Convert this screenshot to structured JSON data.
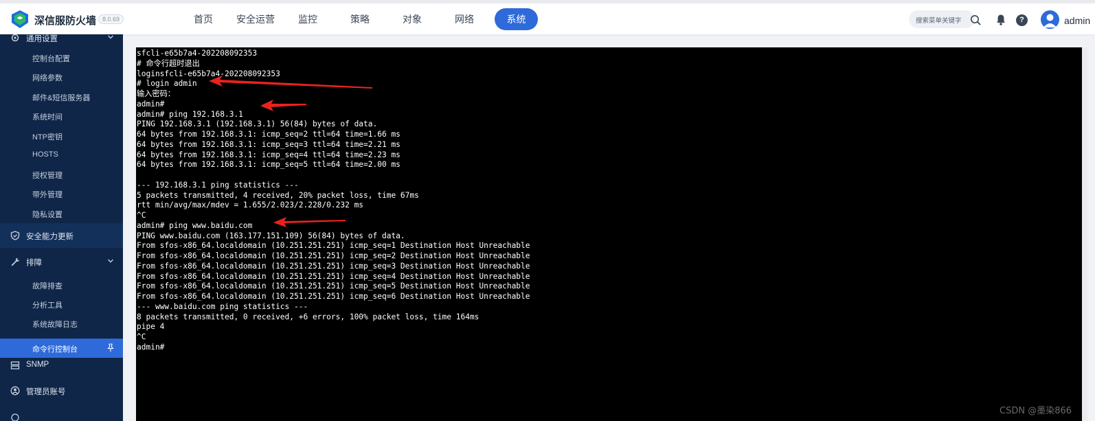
{
  "header": {
    "brand": "深信服防火墙",
    "version": "8.0.69",
    "nav": [
      {
        "label": "首页"
      },
      {
        "label": "安全运营"
      },
      {
        "label": "监控"
      },
      {
        "label": "策略"
      },
      {
        "label": "对象"
      },
      {
        "label": "网络"
      },
      {
        "label": "系统",
        "active": true
      }
    ],
    "search_placeholder": "搜索菜单关键字",
    "username": "admin",
    "help_glyph": "?"
  },
  "sidebar": {
    "top_section_label": "通用设置",
    "general_items": [
      "控制台配置",
      "网络参数",
      "邮件&短信服务器",
      "系统时间",
      "NTP密钥",
      "HOSTS",
      "授权管理",
      "带外管理",
      "隐私设置"
    ],
    "security_update_label": "安全能力更新",
    "troubleshoot_label": "排障",
    "troubleshoot_items": [
      "故障排查",
      "分析工具",
      "系统故障日志"
    ],
    "active_item": "命令行控制台",
    "snmp_label": "SNMP",
    "admin_account_label": "管理员账号",
    "accent_color": "#2e6ad9",
    "background_color": "#0f2648"
  },
  "terminal": {
    "lines": [
      "sfcli-e65b7a4-202208092353",
      "# 命令行超时退出",
      "loginsfcli-e65b7a4-202208092353",
      "# login admin",
      "输入密码：",
      "admin#",
      "admin# ping 192.168.3.1",
      "PING 192.168.3.1 (192.168.3.1) 56(84) bytes of data.",
      "64 bytes from 192.168.3.1: icmp_seq=2 ttl=64 time=1.66 ms",
      "64 bytes from 192.168.3.1: icmp_seq=3 ttl=64 time=2.21 ms",
      "64 bytes from 192.168.3.1: icmp_seq=4 ttl=64 time=2.23 ms",
      "64 bytes from 192.168.3.1: icmp_seq=5 ttl=64 time=2.00 ms",
      "",
      "--- 192.168.3.1 ping statistics ---",
      "5 packets transmitted, 4 received, 20% packet loss, time 67ms",
      "rtt min/avg/max/mdev = 1.655/2.023/2.228/0.232 ms",
      "^C",
      "admin# ping www.baidu.com",
      "PING www.baidu.com (163.177.151.109) 56(84) bytes of data.",
      "From sfos-x86_64.localdomain (10.251.251.251) icmp_seq=1 Destination Host Unreachable",
      "From sfos-x86_64.localdomain (10.251.251.251) icmp_seq=2 Destination Host Unreachable",
      "From sfos-x86_64.localdomain (10.251.251.251) icmp_seq=3 Destination Host Unreachable",
      "From sfos-x86_64.localdomain (10.251.251.251) icmp_seq=4 Destination Host Unreachable",
      "From sfos-x86_64.localdomain (10.251.251.251) icmp_seq=5 Destination Host Unreachable",
      "From sfos-x86_64.localdomain (10.251.251.251) icmp_seq=6 Destination Host Unreachable",
      "--- www.baidu.com ping statistics ---",
      "8 packets transmitted, 0 received, +6 errors, 100% packet loss, time 164ms",
      "pipe 4",
      "^C",
      "admin#"
    ],
    "annotation_color": "#e8231e"
  },
  "watermark": "CSDN @墨染866"
}
